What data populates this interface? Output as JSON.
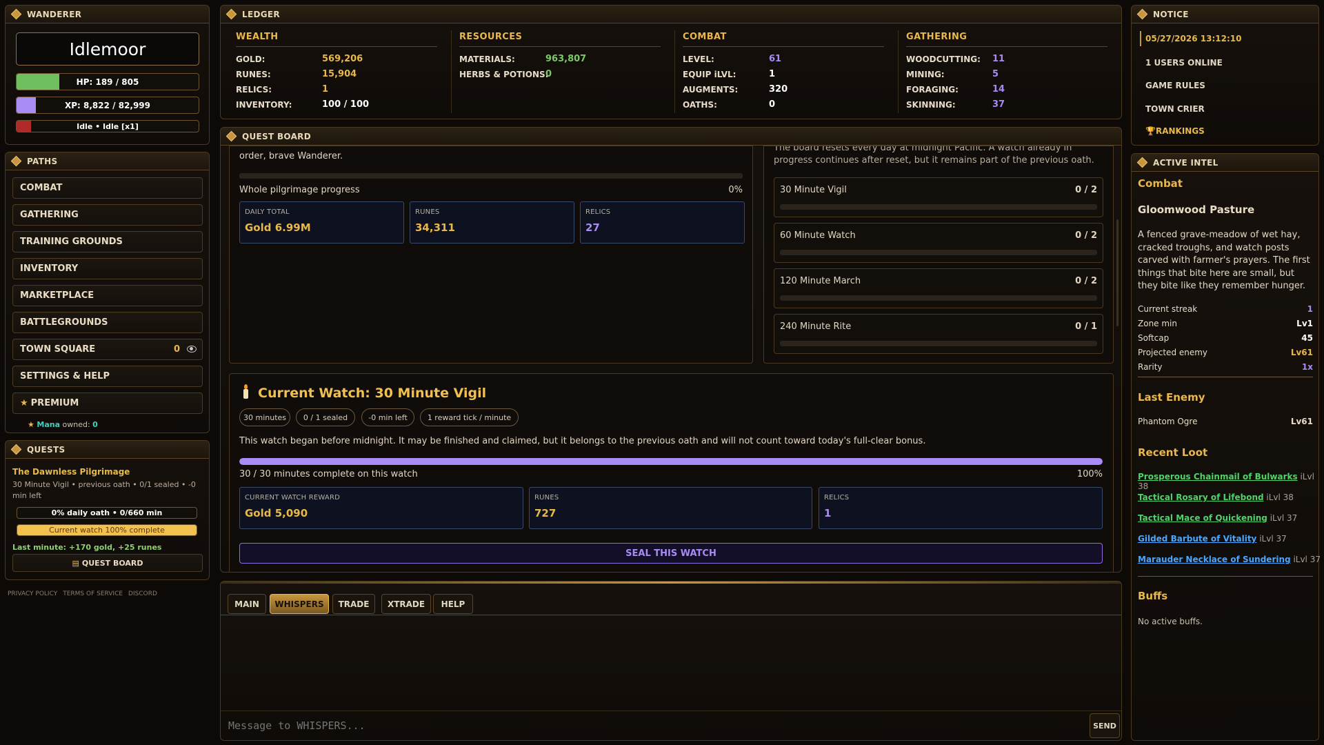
{
  "wanderer": {
    "header": "WANDERER",
    "name": "Idlemoor",
    "hp": {
      "text": "HP: 189 / 805",
      "fraction": 0.235
    },
    "xp": {
      "text": "XP: 8,822 / 82,999",
      "fraction": 0.106
    },
    "idle": {
      "text": "Idle • Idle [x1]",
      "fraction": 0.08
    }
  },
  "paths": {
    "header": "PATHS",
    "items": [
      "COMBAT",
      "GATHERING",
      "TRAINING GROUNDS",
      "INVENTORY",
      "MARKETPLACE",
      "BATTLEGROUNDS",
      "TOWN SQUARE",
      "SETTINGS & HELP",
      "PREMIUM"
    ],
    "town_square_count": "0",
    "mana_label": "Mana",
    "mana_suffix": "owned:",
    "mana_value": "0"
  },
  "quests": {
    "header": "QUESTS",
    "title": "The Dawnless Pilgrimage",
    "desc": "30 Minute Vigil • previous oath • 0/1 sealed • -0 min left",
    "daily_bar": {
      "text": "0% daily oath • 0/660 min",
      "fraction": 0.0
    },
    "watch_bar": {
      "text": "Current watch 100% complete",
      "fraction": 1.0
    },
    "last_minute": "Last minute: +170 gold, +25 runes",
    "button": "QUEST BOARD"
  },
  "footer": [
    "PRIVACY POLICY",
    "TERMS OF SERVICE",
    "DISCORD"
  ],
  "ledger": {
    "header": "LEDGER",
    "columns": [
      {
        "title": "WEALTH",
        "rows": [
          [
            "GOLD:",
            "569,206",
            "gold"
          ],
          [
            "RUNES:",
            "15,904",
            "gold"
          ],
          [
            "RELICS:",
            "1",
            "gold"
          ],
          [
            "INVENTORY:",
            "100 / 100",
            "white"
          ]
        ]
      },
      {
        "title": "RESOURCES",
        "rows": [
          [
            "MATERIALS:",
            "963,807",
            "green"
          ],
          [
            "HERBS & POTIONS:",
            "0",
            "green"
          ]
        ]
      },
      {
        "title": "COMBAT",
        "rows": [
          [
            "LEVEL:",
            "61",
            "purp"
          ],
          [
            "EQUIP iLVL:",
            "1",
            "white"
          ],
          [
            "AUGMENTS:",
            "320",
            "white"
          ],
          [
            "OATHS:",
            "0",
            "white"
          ]
        ]
      },
      {
        "title": "GATHERING",
        "rows": [
          [
            "WOODCUTTING:",
            "11",
            "purp"
          ],
          [
            "MINING:",
            "5",
            "purp"
          ],
          [
            "FORAGING:",
            "14",
            "purp"
          ],
          [
            "SKINNING:",
            "37",
            "purp"
          ]
        ]
      }
    ]
  },
  "quest_board": {
    "header": "QUEST BOARD",
    "intro_tail": "order, brave Wanderer.",
    "reset_text": "The board resets every day at midnight Pacific. A watch already in progress continues after reset, but it remains part of the previous oath.",
    "whole_progress_label": "Whole pilgrimage progress",
    "whole_progress_pct": "0%",
    "whole_progress_fraction": 0.0,
    "totals": [
      {
        "label": "DAILY TOTAL",
        "value": "Gold 6.99M",
        "color": "gold"
      },
      {
        "label": "RUNES",
        "value": "34,311",
        "color": "gold"
      },
      {
        "label": "RELICS",
        "value": "27",
        "color": "purp"
      }
    ],
    "vigils": [
      {
        "name": "30 Minute Vigil",
        "count": "0 / 2"
      },
      {
        "name": "60 Minute Watch",
        "count": "0 / 2"
      },
      {
        "name": "120 Minute March",
        "count": "0 / 2"
      },
      {
        "name": "240 Minute Rite",
        "count": "0 / 1"
      }
    ],
    "current": {
      "title": "Current Watch: 30 Minute Vigil",
      "pills": [
        "30 minutes",
        "0 / 1 sealed",
        "-0 min left",
        "1 reward tick / minute"
      ],
      "note": "This watch began before midnight. It may be finished and claimed, but it belongs to the previous oath and will not count toward today's full-clear bonus.",
      "progress_fraction": 1.0,
      "progress_text": "30 / 30 minutes complete on this watch",
      "progress_pct": "100%",
      "rewards": [
        {
          "label": "CURRENT WATCH REWARD",
          "value": "Gold 5,090",
          "color": "gold"
        },
        {
          "label": "RUNES",
          "value": "727",
          "color": "gold"
        },
        {
          "label": "RELICS",
          "value": "1",
          "color": "purp"
        }
      ],
      "seal_button": "SEAL THIS WATCH"
    }
  },
  "chat": {
    "tabs": [
      "MAIN",
      "WHISPERS",
      "TRADE",
      "XTRADE",
      "HELP"
    ],
    "active_tab": "WHISPERS",
    "placeholder": "Message to WHISPERS...",
    "send": "SEND"
  },
  "notice": {
    "header": "NOTICE",
    "datetime": "05/27/2026 13:12:10",
    "items": [
      "1 USERS ONLINE",
      "GAME RULES",
      "TOWN CRIER",
      "RANKINGS"
    ]
  },
  "intel": {
    "header": "ACTIVE INTEL",
    "section": "Combat",
    "zone": "Gloomwood Pasture",
    "zone_desc": "A fenced grave-meadow of wet hay, cracked troughs, and watch posts carved with farmer's prayers. The first things that bite here are small, but they bite like they remember hunger.",
    "stats": [
      {
        "label": "Current streak",
        "value": "1",
        "color": "purp"
      },
      {
        "label": "Zone min",
        "value": "Lv1",
        "color": "white"
      },
      {
        "label": "Softcap",
        "value": "45",
        "color": "white"
      },
      {
        "label": "Projected enemy",
        "value": "Lv61",
        "color": "gold"
      },
      {
        "label": "Rarity",
        "value": "1x",
        "color": "purp"
      }
    ],
    "last_enemy_header": "Last Enemy",
    "last_enemy": {
      "name": "Phantom Ogre",
      "level": "Lv61"
    },
    "loot_header": "Recent Loot",
    "loot": [
      {
        "name": "Prosperous Chainmail of Bulwarks",
        "ilvl": "iLvl 38",
        "color": "#4fd36a"
      },
      {
        "name": "Tactical Rosary of Lifebond",
        "ilvl": "iLvl 38",
        "color": "#4fd36a"
      },
      {
        "name": "Tactical Mace of Quickening",
        "ilvl": "iLvl 37",
        "color": "#4fd36a"
      },
      {
        "name": "Gilded Barbute of Vitality",
        "ilvl": "iLvl 37",
        "color": "#4aa6ff"
      },
      {
        "name": "Marauder Necklace of Sundering",
        "ilvl": "iLvl 37",
        "color": "#4aa6ff"
      }
    ],
    "buffs_header": "Buffs",
    "buffs_text": "No active buffs."
  },
  "colors": {
    "gold": "#e8b84a",
    "purple": "#a98bf5",
    "green": "#7dc96a",
    "hp": "#6fbf5f",
    "xp": "#a98bf5",
    "idle": "#b02a2a",
    "watch": "#f2c14e"
  }
}
